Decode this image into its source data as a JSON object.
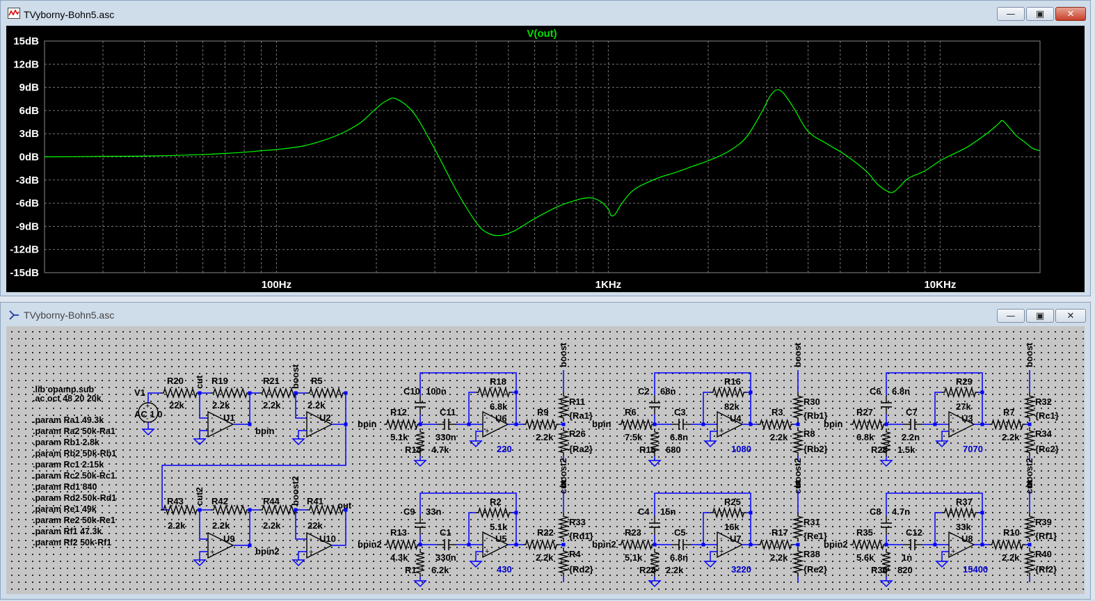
{
  "plot_window": {
    "title": "TVyborny-Bohn5.asc",
    "trace_label": "V(out)",
    "trace_color": "#00ff00",
    "background": "#000000"
  },
  "schematic_window": {
    "title": "TVyborny-Bohn5.asc",
    "directives": [
      ".lib opamp.sub",
      ".ac oct 48 20 20k",
      ".param Ra1 49.3k",
      ".param Ra2 50k-Ra1",
      ".param Rb1 2.8k",
      ".param Rb2 50k-Rb1",
      ".param Rc1 2.15k",
      ".param Rc2 50k-Rc1",
      ".param Rd1 840",
      ".param Rd2 50k-Rd1",
      ".param Re1 49k",
      ".param Re2 50k-Re1",
      ".param Rf1 47.3k",
      ".param Rf2 50k-Rf1"
    ],
    "source": {
      "name": "V1",
      "value": "AC 1 0"
    },
    "chain1": {
      "R20": [
        "R20",
        "22k"
      ],
      "R19": [
        "R19",
        "2.2k"
      ],
      "R21": [
        "R21",
        "2.2k"
      ],
      "R5": [
        "R5",
        "2.2k"
      ],
      "U1": "U1",
      "U2": "U2",
      "net_cut": "cut",
      "net_boost": "boost",
      "net_bpin": "bpin"
    },
    "chain2": {
      "R43": [
        "R43",
        "2.2k"
      ],
      "R42": [
        "R42",
        "2.2k"
      ],
      "R44": [
        "R44",
        "2.2k"
      ],
      "R41": [
        "R41",
        "22k"
      ],
      "U9": "U9",
      "U10": "U10",
      "net_cut": "cut2",
      "net_boost": "boost2",
      "net_bpin": "bpin2",
      "net_out": "out"
    },
    "bands": [
      {
        "in": "bpin",
        "Rin": [
          "R12",
          "5.1k"
        ],
        "Rg": [
          "R14",
          "4.7k"
        ],
        "Ca": [
          "C10",
          "100n"
        ],
        "Cb": [
          "C11",
          "330n"
        ],
        "Rf": [
          "R18",
          "6.8k"
        ],
        "U": "U6",
        "freq": "220",
        "Rs": [
          "R9",
          "2.2k"
        ],
        "Rt": [
          "R11",
          "{Ra1}"
        ],
        "Rb": [
          "R26",
          "{Ra2}"
        ],
        "top": "boost",
        "bottom": "cut"
      },
      {
        "in": "bpin",
        "Rin": [
          "R6",
          "7.5k"
        ],
        "Rg": [
          "R15",
          "680"
        ],
        "Ca": [
          "C2",
          "68n"
        ],
        "Cb": [
          "C3",
          "6.8n"
        ],
        "Rf": [
          "R16",
          "82k"
        ],
        "U": "U4",
        "freq": "1080",
        "Rs": [
          "R3",
          "2.2k"
        ],
        "Rt": [
          "R30",
          "{Rb1}"
        ],
        "Rb": [
          "R8",
          "{Rb2}"
        ],
        "top": "boost",
        "bottom": "cut"
      },
      {
        "in": "bpin",
        "Rin": [
          "R27",
          "6.8k"
        ],
        "Rg": [
          "R28",
          "1.5k"
        ],
        "Ca": [
          "C6",
          "6.8n"
        ],
        "Cb": [
          "C7",
          "2.2n"
        ],
        "Rf": [
          "R29",
          "27k"
        ],
        "U": "U3",
        "freq": "7070",
        "Rs": [
          "R7",
          "2.2k"
        ],
        "Rt": [
          "R32",
          "{Rc1}"
        ],
        "Rb": [
          "R34",
          "{Rc2}"
        ],
        "top": "boost",
        "bottom": "cut"
      },
      {
        "in": "bpin2",
        "Rin": [
          "R13",
          "4.3k"
        ],
        "Rg": [
          "R1",
          "6.2k"
        ],
        "Ca": [
          "C9",
          "33n"
        ],
        "Cb": [
          "C1",
          "330n"
        ],
        "Rf": [
          "R2",
          "5.1k"
        ],
        "U": "U5",
        "freq": "430",
        "Rs": [
          "R22",
          "2.2k"
        ],
        "Rt": [
          "R33",
          "{Rd1}"
        ],
        "Rb": [
          "R4",
          "{Rd2}"
        ],
        "top": "boost2",
        "bottom": "cut2"
      },
      {
        "in": "bpin2",
        "Rin": [
          "R23",
          "5.1k"
        ],
        "Rg": [
          "R24",
          "2.2k"
        ],
        "Ca": [
          "C4",
          "15n"
        ],
        "Cb": [
          "C5",
          "6.8n"
        ],
        "Rf": [
          "R25",
          "16k"
        ],
        "U": "U7",
        "freq": "3220",
        "Rs": [
          "R17",
          "2.2k"
        ],
        "Rt": [
          "R31",
          "{Re1}"
        ],
        "Rb": [
          "R38",
          "{Re2}"
        ],
        "top": "boost2",
        "bottom": "cut2"
      },
      {
        "in": "bpin2",
        "Rin": [
          "R35",
          "5.6k"
        ],
        "Rg": [
          "R36",
          "820"
        ],
        "Ca": [
          "C8",
          "4.7n"
        ],
        "Cb": [
          "C12",
          "1n"
        ],
        "Rf": [
          "R37",
          "33k"
        ],
        "U": "U8",
        "freq": "15400",
        "Rs": [
          "R10",
          "2.2k"
        ],
        "Rt": [
          "R39",
          "{Rf1}"
        ],
        "Rb": [
          "R40",
          "{Rf2}"
        ],
        "top": "boost2",
        "bottom": "cut2"
      }
    ],
    "wire_color": "#0000ff",
    "freq_label_color": "#0000cc"
  },
  "chart_data": {
    "type": "line",
    "title": "V(out)",
    "xscale": "log",
    "xlim": [
      20,
      20000
    ],
    "ylim": [
      -15,
      15
    ],
    "grid": true,
    "y_ticks": [
      "15dB",
      "12dB",
      "9dB",
      "6dB",
      "3dB",
      "0dB",
      "-3dB",
      "-6dB",
      "-9dB",
      "-12dB",
      "-15dB"
    ],
    "y_tick_values": [
      15,
      12,
      9,
      6,
      3,
      0,
      -3,
      -6,
      -9,
      -12,
      -15
    ],
    "x_ticks": [
      "100Hz",
      "1KHz",
      "10KHz"
    ],
    "x_tick_values": [
      100,
      1000,
      10000
    ],
    "series": [
      {
        "name": "V(out)",
        "color": "#00ff00",
        "x": [
          20,
          30,
          40,
          50,
          60,
          70,
          80,
          90,
          100,
          120,
          140,
          160,
          180,
          200,
          215,
          230,
          260,
          300,
          350,
          400,
          430,
          470,
          520,
          600,
          700,
          800,
          880,
          950,
          1000,
          1020,
          1050,
          1100,
          1200,
          1400,
          1600,
          1800,
          2000,
          2300,
          2600,
          2900,
          3100,
          3300,
          3600,
          4000,
          4600,
          5200,
          6000,
          6500,
          7100,
          7500,
          8000,
          9000,
          10000,
          11000,
          12000,
          13000,
          14000,
          15000,
          15400,
          16000,
          17000,
          18000,
          19000,
          20000
        ],
        "y": [
          0,
          0.05,
          0.1,
          0.2,
          0.3,
          0.45,
          0.6,
          0.8,
          0.95,
          1.4,
          2.2,
          3.2,
          4.5,
          6.3,
          7.3,
          7.5,
          5.6,
          1.0,
          -4.5,
          -8.5,
          -9.8,
          -10.2,
          -9.6,
          -8.0,
          -6.5,
          -5.6,
          -5.3,
          -5.8,
          -6.8,
          -7.6,
          -7.4,
          -6.0,
          -4.2,
          -2.8,
          -2.0,
          -1.2,
          -0.5,
          0.7,
          2.5,
          5.8,
          8.1,
          8.6,
          6.5,
          3.3,
          1.6,
          0.2,
          -1.9,
          -3.6,
          -4.6,
          -4.0,
          -2.8,
          -1.8,
          -0.5,
          0.4,
          1.2,
          2.2,
          3.2,
          4.3,
          4.7,
          4.0,
          2.7,
          1.9,
          1.1,
          0.8
        ]
      }
    ]
  }
}
